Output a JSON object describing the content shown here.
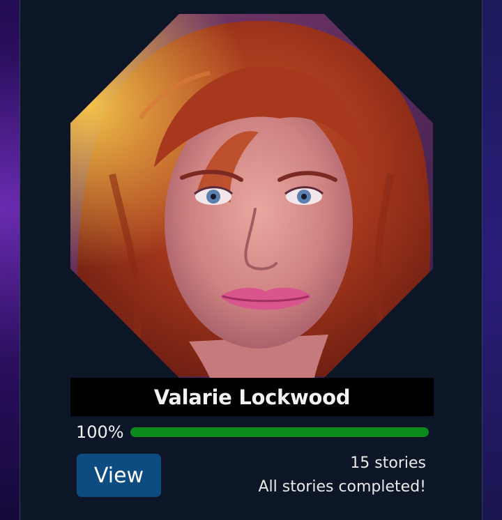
{
  "character": {
    "name": "Valarie Lockwood",
    "portrait_alt": "portrait of a woman with red hair"
  },
  "progress": {
    "label": "100%",
    "fraction": 1.0
  },
  "actions": {
    "view_label": "View"
  },
  "stats": {
    "stories": "15 stories",
    "status": "All stories completed!"
  },
  "colors": {
    "card_bg": "#0d1626",
    "progress_fill": "#0b8a1e",
    "button_bg": "#0d4c80"
  }
}
